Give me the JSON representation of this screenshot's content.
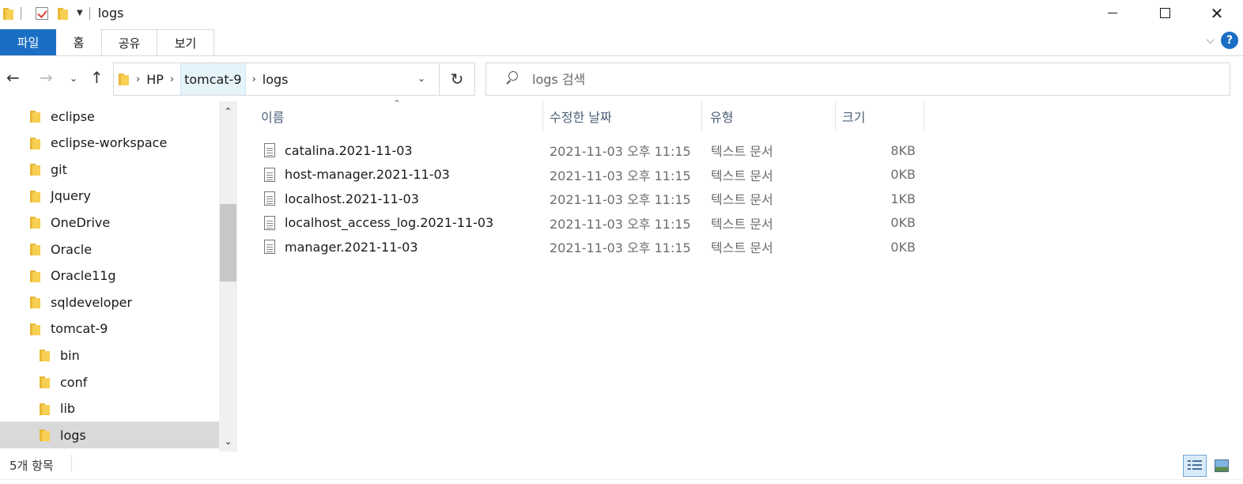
{
  "window": {
    "title": "logs",
    "controls": {
      "minimize": "minimize",
      "maximize": "maximize",
      "close": "✕"
    }
  },
  "ribbon": {
    "tabs": [
      {
        "label": "파일",
        "active": true
      },
      {
        "label": "홈"
      },
      {
        "label": "공유"
      },
      {
        "label": "보기"
      }
    ],
    "help": "?"
  },
  "address": {
    "crumbs": [
      "HP",
      "tomcat-9",
      "logs"
    ],
    "search_placeholder": "logs 검색"
  },
  "navpane": {
    "items": [
      {
        "label": "eclipse",
        "level": 0
      },
      {
        "label": "eclipse-workspace",
        "level": 0
      },
      {
        "label": "git",
        "level": 0
      },
      {
        "label": "Jquery",
        "level": 0
      },
      {
        "label": "OneDrive",
        "level": 0
      },
      {
        "label": "Oracle",
        "level": 0
      },
      {
        "label": "Oracle11g",
        "level": 0
      },
      {
        "label": "sqldeveloper",
        "level": 0
      },
      {
        "label": "tomcat-9",
        "level": 0
      },
      {
        "label": "bin",
        "level": 1
      },
      {
        "label": "conf",
        "level": 1
      },
      {
        "label": "lib",
        "level": 1
      },
      {
        "label": "logs",
        "level": 1,
        "selected": true
      }
    ]
  },
  "filelist": {
    "columns": {
      "name": "이름",
      "date": "수정한 날짜",
      "type": "유형",
      "size": "크기"
    },
    "rows": [
      {
        "name": "catalina.2021-11-03",
        "date": "2021-11-03 오후 11:15",
        "type": "텍스트 문서",
        "size": "8KB"
      },
      {
        "name": "host-manager.2021-11-03",
        "date": "2021-11-03 오후 11:15",
        "type": "텍스트 문서",
        "size": "0KB"
      },
      {
        "name": "localhost.2021-11-03",
        "date": "2021-11-03 오후 11:15",
        "type": "텍스트 문서",
        "size": "1KB"
      },
      {
        "name": "localhost_access_log.2021-11-03",
        "date": "2021-11-03 오후 11:15",
        "type": "텍스트 문서",
        "size": "0KB"
      },
      {
        "name": "manager.2021-11-03",
        "date": "2021-11-03 오후 11:15",
        "type": "텍스트 문서",
        "size": "0KB"
      }
    ]
  },
  "status": {
    "item_count": "5개 항목"
  },
  "colors": {
    "accent": "#1a6fc4",
    "selection": "#d9d9d9",
    "folder": "#f7cf52"
  }
}
